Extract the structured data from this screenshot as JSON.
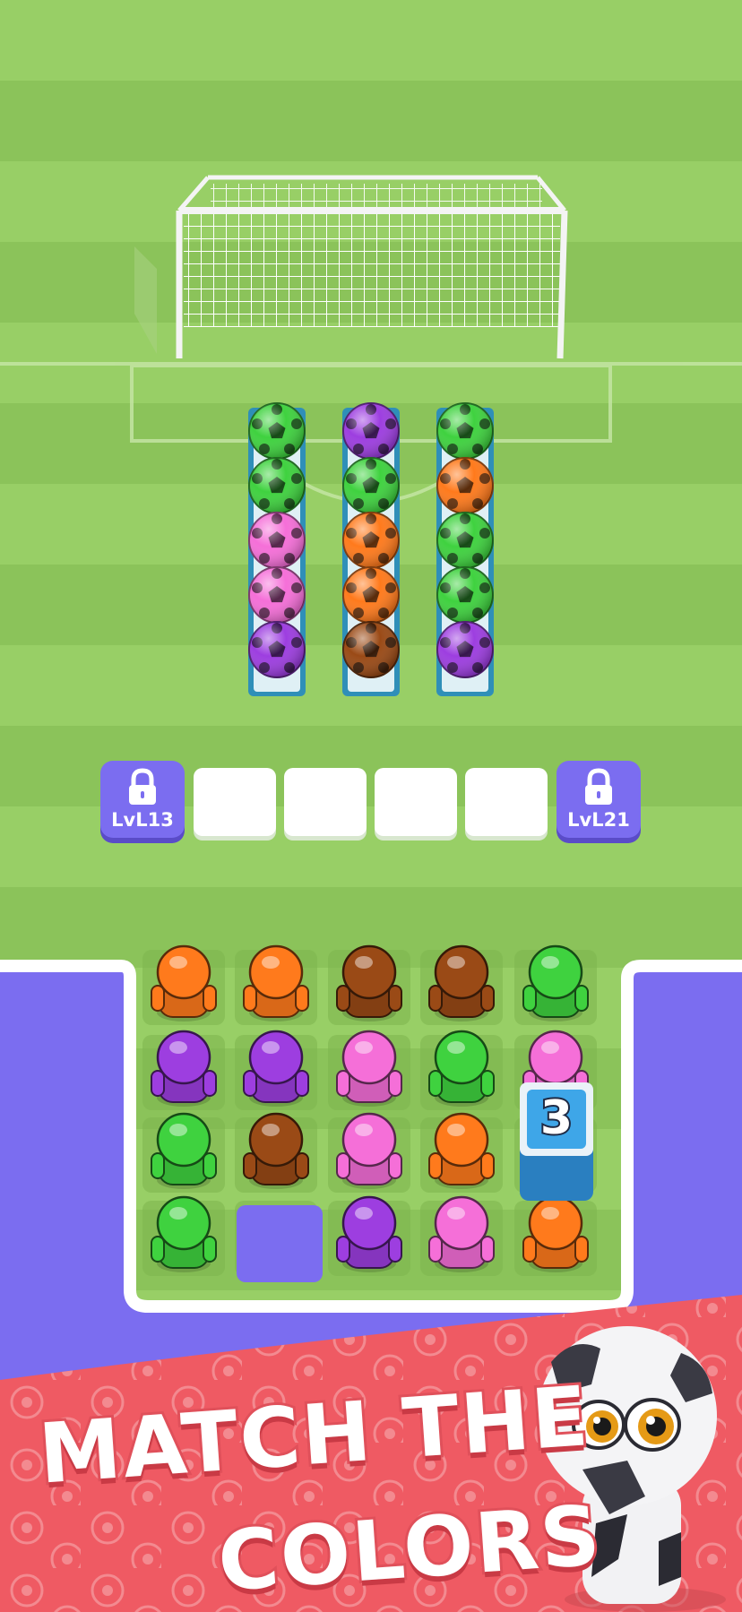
{
  "colors": {
    "green": "#3fd23f",
    "purple": "#9d3ee0",
    "pink": "#f56fd8",
    "orange": "#ff7a1c",
    "brown": "#9a4a16",
    "grass_light": "#98cf66",
    "grass_dark": "#8bc35a",
    "purple_bg": "#7b6df0",
    "banner_red": "#ef5a63"
  },
  "ball_tubes": [
    {
      "balls": [
        "green",
        "green",
        "pink",
        "pink",
        "purple"
      ]
    },
    {
      "balls": [
        "purple",
        "green",
        "orange",
        "orange",
        "brown"
      ]
    },
    {
      "balls": [
        "green",
        "orange",
        "green",
        "green",
        "purple"
      ]
    }
  ],
  "holding_slots": {
    "locked_left": {
      "icon": "lock-icon",
      "label": "LvL13"
    },
    "locked_right": {
      "icon": "lock-icon",
      "label": "LvL21"
    },
    "empty_count": 4
  },
  "player_grid": [
    [
      "orange",
      "orange",
      "brown",
      "brown",
      "green"
    ],
    [
      "purple",
      "purple",
      "pink",
      "green",
      "pink"
    ],
    [
      "green",
      "brown",
      "pink",
      "orange",
      "counter"
    ],
    [
      "green",
      "empty",
      "purple",
      "pink",
      "orange"
    ]
  ],
  "counter_block": {
    "value": "3"
  },
  "banner": {
    "line1": "MATCH THE",
    "line2": "COLORS"
  }
}
